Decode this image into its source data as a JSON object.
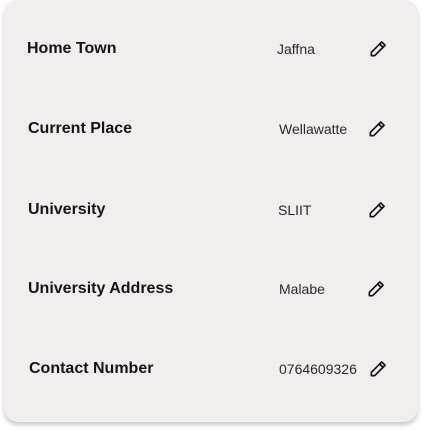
{
  "profile_fields": [
    {
      "label": "Home Town",
      "value": "Jaffna",
      "icon": "pencil-icon"
    },
    {
      "label": "Current Place",
      "value": "Wellawatte",
      "icon": "pencil-icon"
    },
    {
      "label": "University",
      "value": "SLIIT",
      "icon": "pencil-icon"
    },
    {
      "label": "University Address",
      "value": "Malabe",
      "icon": "pencil-icon"
    },
    {
      "label": "Contact Number",
      "value": "0764609326",
      "icon": "pencil-icon"
    }
  ]
}
